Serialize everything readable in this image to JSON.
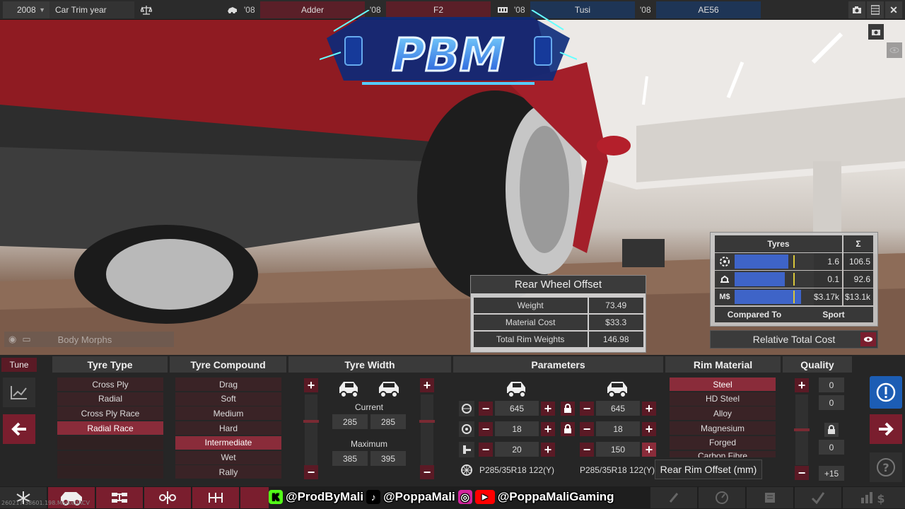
{
  "topbar": {
    "year": "2008",
    "trim_label": "Car Trim year",
    "slots": [
      {
        "year": "'08",
        "name": "Adder"
      },
      {
        "year": "'08",
        "name": "F2"
      },
      {
        "year": "'08",
        "name": "Tusi"
      },
      {
        "year": "'08",
        "name": "AE56"
      }
    ]
  },
  "logo_text": "PBM",
  "offset_panel": {
    "title": "Rear Wheel Offset",
    "rows": [
      {
        "label": "Weight",
        "value": "73.49"
      },
      {
        "label": "Material Cost",
        "value": "$33.3"
      },
      {
        "label": "Total Rim Weights",
        "value": "146.98"
      }
    ]
  },
  "tyre_panel": {
    "title": "Tyres",
    "sum_symbol": "Σ",
    "rows": [
      {
        "icon": "grip-icon",
        "label": "",
        "fill": 0.68,
        "mark": 0.74,
        "value": "1.6",
        "total": "106.5"
      },
      {
        "icon": "comfort-icon",
        "label": "",
        "fill": 0.63,
        "mark": 0.74,
        "value": "0.1",
        "total": "92.6"
      },
      {
        "icon": "money-icon",
        "label": "M$",
        "fill": 0.84,
        "mark": 0.74,
        "value": "$3.17k",
        "total": "$13.1k"
      }
    ],
    "compared_to_label": "Compared To",
    "compared_to_value": "Sport"
  },
  "relative_total_cost": "Relative Total Cost",
  "body_morphs": "Body Morphs",
  "tune_tab": "Tune",
  "columns": {
    "tyre_type": "Tyre Type",
    "tyre_compound": "Tyre Compound",
    "tyre_width": "Tyre Width",
    "parameters": "Parameters",
    "rim_material": "Rim Material",
    "quality": "Quality"
  },
  "tyre_types": [
    "Cross Ply",
    "Radial",
    "Cross Ply Race",
    "Radial Race",
    "",
    "",
    ""
  ],
  "tyre_type_selected": 3,
  "tyre_compounds": [
    "Drag",
    "Soft",
    "Medium",
    "Hard",
    "Intermediate",
    "Wet",
    "Rally"
  ],
  "tyre_compound_selected": 4,
  "tyre_width": {
    "current_label": "Current",
    "current_front": "285",
    "current_rear": "285",
    "maximum_label": "Maximum",
    "max_front": "385",
    "max_rear": "395"
  },
  "parameters": {
    "rows": [
      {
        "front": "645",
        "rear": "645"
      },
      {
        "front": "18",
        "rear": "18"
      },
      {
        "front": "20",
        "rear": "150"
      }
    ],
    "tyre_front": "P285/35R18 122(Y)",
    "tyre_rear": "P285/35R18 122(Y)"
  },
  "rim_materials": [
    "Steel",
    "HD Steel",
    "Alloy",
    "Magnesium",
    "Forged",
    "Carbon Fibre"
  ],
  "rim_material_selected": 0,
  "quality": {
    "values": [
      "0",
      "0",
      "0"
    ],
    "bottom": "+15"
  },
  "tooltip": "Rear Rim Offset (mm)",
  "social": {
    "kick": "@ProdByMali",
    "tiktok": "@PoppaMali",
    "insta_yt": "@PoppaMaliGaming"
  },
  "version": "260217.38601.198.MarketIRCV"
}
